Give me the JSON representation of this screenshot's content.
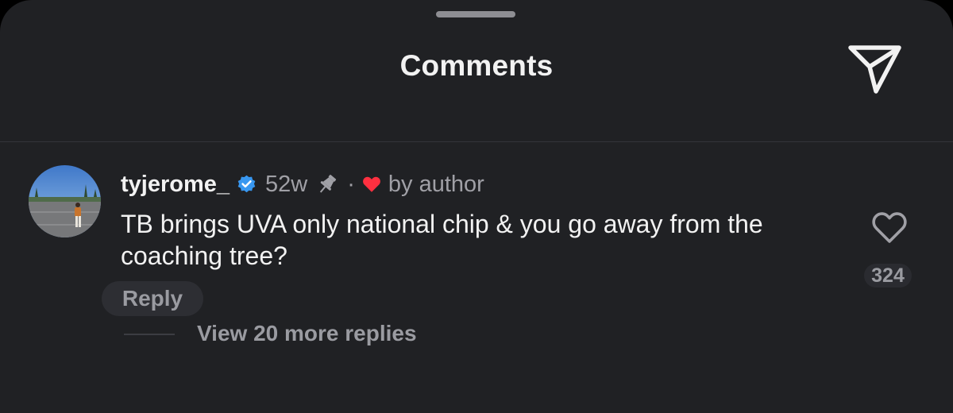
{
  "header": {
    "title": "Comments",
    "share_icon": "send-paper-plane-icon"
  },
  "comment": {
    "username": "tyjerome_",
    "verified": true,
    "time": "52w",
    "pinned": true,
    "separator": "·",
    "author_liked_label": "by author",
    "text": "TB brings UVA only national chip & you go away from the coaching tree?",
    "like_count": "324",
    "reply_label": "Reply",
    "view_replies_label": "View 20 more replies"
  },
  "colors": {
    "background": "#202124",
    "verified_badge": "#3897f0",
    "author_heart": "#ff3040"
  }
}
